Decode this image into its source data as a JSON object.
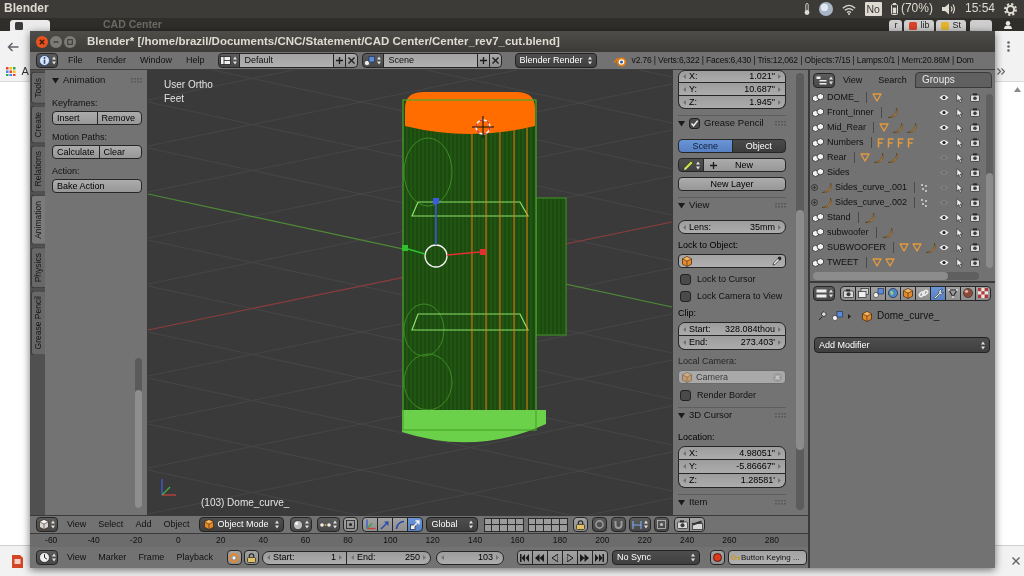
{
  "top_bar": {
    "app_name": "Blender",
    "keyboard_layout": "No",
    "battery": "(70%)",
    "clock": "15:54"
  },
  "browser": {
    "faded_title": "CAD Center",
    "tabs": [
      {
        "selected": true,
        "color": "#3a3a3a"
      },
      {
        "title": "r",
        "selected": false
      },
      {
        "title": "lib",
        "selected": false,
        "color": "#d9452b"
      },
      {
        "title": "St",
        "selected": false,
        "color": "#e6b52e"
      }
    ],
    "bookmarks": [
      {
        "title": "A"
      }
    ]
  },
  "window": {
    "title": "Blender* [/home/brazil/Documents/CNC/Statement/CAD Center/Center_rev7_cut.blend]"
  },
  "info_header": {
    "menus": [
      "File",
      "Render",
      "Window",
      "Help"
    ],
    "screen_layout": "Default",
    "scene": "Scene",
    "render_engine": "Blender Render",
    "stats": "v2.76 | Verts:6,322 | Faces:6,430 | Tris:12,062 | Objects:7/15 | Lamps:0/1 | Mem:20.86M | Dom"
  },
  "tool_shelf": {
    "tabs": [
      {
        "label": "Tools",
        "selected": false
      },
      {
        "label": "Create",
        "selected": false
      },
      {
        "label": "Relations",
        "selected": false
      },
      {
        "label": "Animation",
        "selected": true
      },
      {
        "label": "Physics",
        "selected": false
      },
      {
        "label": "Grease Pencil",
        "selected": false
      }
    ],
    "panels": [
      {
        "title": "Animation",
        "expanded": true,
        "groups": [
          {
            "label": "Keyframes:",
            "buttons": [
              "Insert",
              "Remove"
            ]
          },
          {
            "label": "Motion Paths:",
            "buttons": [
              "Calculate",
              "Clear"
            ]
          },
          {
            "label": "Action:",
            "buttons": [
              "Bake Action"
            ]
          }
        ]
      }
    ]
  },
  "viewport": {
    "view_name": "User Ortho",
    "units": "Feet",
    "status": "(103) Dome_curve_"
  },
  "sidebar": {
    "fields": [
      {
        "label": "X:",
        "value": "1.021\""
      },
      {
        "label": "Y:",
        "value": "10.687\""
      },
      {
        "label": "Z:",
        "value": "1.945\""
      }
    ],
    "panels": [
      {
        "title": "Grease Pencil",
        "expanded": true,
        "checked": true,
        "rows": [
          {
            "kind": "toggle",
            "disabled": false,
            "options": [
              {
                "label": "Scene",
                "selected": true
              },
              {
                "label": "Object",
                "selected": false
              }
            ]
          },
          {
            "kind": "datablock",
            "disabled": false,
            "label": "New"
          },
          {
            "kind": "button",
            "disabled": false,
            "label": "New Layer"
          }
        ]
      },
      {
        "title": "View",
        "expanded": true,
        "rows": [
          {
            "kind": "number",
            "disabled": false,
            "fields": [
              {
                "label": "Lens:",
                "value": "35mm"
              }
            ]
          },
          {
            "kind": "label",
            "disabled": false,
            "text": "Lock to Object:"
          },
          {
            "kind": "object_picker",
            "disabled": false
          },
          {
            "kind": "checkbox",
            "disabled": false,
            "label": "Lock to Cursor",
            "checked": false
          },
          {
            "kind": "checkbox",
            "disabled": false,
            "label": "Lock Camera to View",
            "checked": false
          },
          {
            "kind": "label",
            "disabled": false,
            "text": "Clip:"
          },
          {
            "kind": "number",
            "disabled": false,
            "fields": [
              {
                "label": "Start:",
                "value": "328.084thou"
              },
              {
                "label": "End:",
                "value": "273.403'"
              }
            ]
          },
          {
            "kind": "label",
            "disabled": true,
            "text": "Local Camera:"
          },
          {
            "kind": "object_field",
            "disabled": true,
            "value": "Camera"
          },
          {
            "kind": "checkbox",
            "disabled": false,
            "label": "Render Border",
            "checked": false
          }
        ]
      },
      {
        "title": "3D Cursor",
        "expanded": true,
        "rows": [
          {
            "kind": "label",
            "disabled": false,
            "text": "Location:"
          },
          {
            "kind": "number",
            "disabled": false,
            "fields": [
              {
                "label": "X:",
                "value": "4.98051\""
              },
              {
                "label": "Y:",
                "value": "-5.86667\""
              },
              {
                "label": "Z:",
                "value": "1.28581'"
              }
            ]
          }
        ]
      },
      {
        "title": "Item",
        "expanded": true
      }
    ]
  },
  "outliner": {
    "menus": [
      "View",
      "Search"
    ],
    "display_mode": "Groups",
    "items": [
      {
        "name": "DOME_",
        "kind": "group",
        "visible": true,
        "data_icons": [
          {
            "kind": "mesh"
          }
        ]
      },
      {
        "name": "Front_Inner",
        "kind": "group",
        "visible": true,
        "data_icons": [
          {
            "kind": "curve"
          }
        ]
      },
      {
        "name": "Mid_Rear",
        "kind": "group",
        "visible": true,
        "data_icons": [
          {
            "kind": "mesh"
          },
          {
            "kind": "curve"
          },
          {
            "kind": "curve"
          }
        ]
      },
      {
        "name": "Numbers",
        "kind": "group",
        "visible": true,
        "data_icons": [
          {
            "kind": "text"
          },
          {
            "kind": "text"
          },
          {
            "kind": "text"
          },
          {
            "kind": "text"
          }
        ]
      },
      {
        "name": "Rear",
        "kind": "group",
        "visible": false,
        "data_icons": [
          {
            "kind": "mesh"
          },
          {
            "kind": "curve"
          },
          {
            "kind": "curve"
          }
        ]
      },
      {
        "name": "Sides",
        "kind": "group",
        "visible": false,
        "children": [
          {
            "name": "Sides_curve_.001",
            "kind": "curve",
            "expanded": false,
            "visible": false,
            "data_icons": [
              {
                "kind": "dots"
              }
            ]
          },
          {
            "name": "Sides_curve_.002",
            "kind": "curve",
            "expanded": false,
            "visible": false,
            "data_icons": [
              {
                "kind": "dots"
              }
            ]
          }
        ]
      },
      {
        "name": "Stand",
        "kind": "group",
        "visible": true,
        "data_icons": [
          {
            "kind": "curve"
          }
        ]
      },
      {
        "name": "subwoofer",
        "kind": "group",
        "visible": true,
        "data_icons": [
          {
            "kind": "curve"
          }
        ]
      },
      {
        "name": "SUBWOOFER",
        "kind": "group",
        "visible": true,
        "data_icons": [
          {
            "kind": "mesh"
          },
          {
            "kind": "mesh"
          },
          {
            "kind": "curve"
          }
        ]
      },
      {
        "name": "TWEET",
        "kind": "group",
        "visible": true,
        "data_icons": [
          {
            "kind": "mesh"
          },
          {
            "kind": "mesh"
          }
        ]
      }
    ]
  },
  "properties": {
    "tabs": [
      {
        "kind": "render",
        "selected": false
      },
      {
        "kind": "render_layers",
        "selected": false
      },
      {
        "kind": "scene",
        "selected": false
      },
      {
        "kind": "world",
        "selected": false
      },
      {
        "kind": "object",
        "selected": false
      },
      {
        "kind": "constraints",
        "selected": false
      },
      {
        "kind": "modifiers",
        "selected": true
      },
      {
        "kind": "data",
        "selected": false
      },
      {
        "kind": "material",
        "selected": false
      },
      {
        "kind": "texture",
        "selected": false
      }
    ],
    "object_name": "Dome_curve_",
    "add_menu": "Add Modifier"
  },
  "viewport_header": {
    "menus": [
      "View",
      "Select",
      "Add",
      "Object"
    ],
    "mode": "Object Mode",
    "manipulators": [
      {
        "kind": "widget",
        "selected": false
      },
      {
        "kind": "translate",
        "selected": false
      },
      {
        "kind": "rotate",
        "selected": false
      },
      {
        "kind": "scale",
        "selected": true
      }
    ],
    "orientation": "Global"
  },
  "timeline": {
    "ruler": [
      "-60",
      "-40",
      "-20",
      "0",
      "20",
      "40",
      "60",
      "80",
      "100",
      "120",
      "140",
      "160",
      "180",
      "200",
      "220",
      "240",
      "260",
      "280"
    ],
    "menus": [
      "View",
      "Marker",
      "Frame",
      "Playback"
    ],
    "frame_range": [
      {
        "label": "Start:",
        "value": "1"
      },
      {
        "label": "End:",
        "value": "250"
      }
    ],
    "current_frame": "103",
    "sync": "No Sync",
    "keying_set": "Button Keying ..."
  }
}
